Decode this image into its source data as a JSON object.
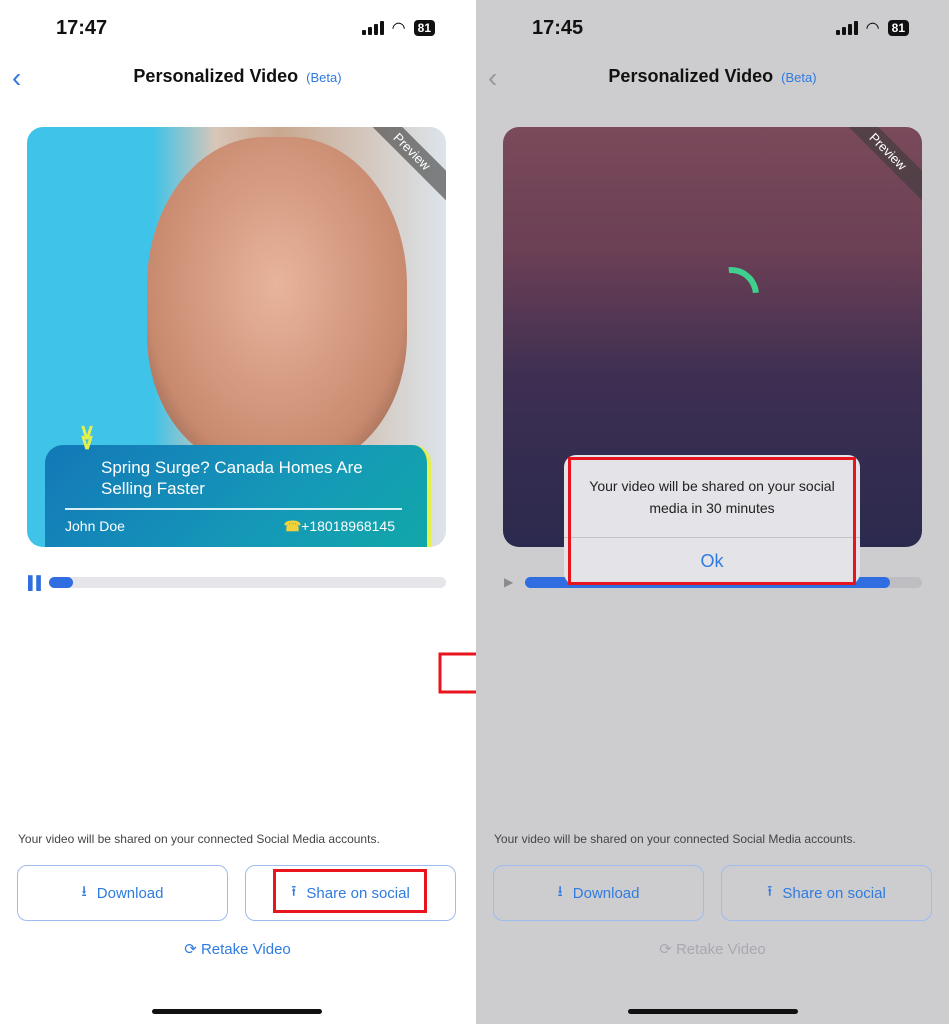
{
  "before": {
    "status_time": "17:47",
    "battery": "81",
    "header": {
      "title": "Personalized Video",
      "badge": "(Beta)"
    },
    "video": {
      "preview_label": "Preview",
      "headline": "Spring Surge? Canada Homes Are Selling Faster",
      "agent_name": "John Doe",
      "phone": "+18018968145",
      "progress_percent": 6,
      "control": "pause-icon"
    },
    "note": "Your video will be shared on your connected Social Media accounts.",
    "buttons": {
      "download": "Download",
      "share": "Share on social",
      "retake": "Retake Video"
    }
  },
  "after": {
    "status_time": "17:45",
    "battery": "81",
    "header": {
      "title": "Personalized Video",
      "badge": "(Beta)"
    },
    "video": {
      "preview_label": "Preview",
      "progress_percent": 92,
      "control": "play-icon"
    },
    "dialog": {
      "message": "Your video will be shared on your social media in 30 minutes",
      "ok": "Ok"
    },
    "note": "Your video will be shared on your connected Social Media accounts.",
    "buttons": {
      "download": "Download",
      "share": "Share on social",
      "retake": "Retake Video"
    }
  },
  "colors": {
    "accent": "#2f7be0",
    "highlight": "#e8141e"
  }
}
